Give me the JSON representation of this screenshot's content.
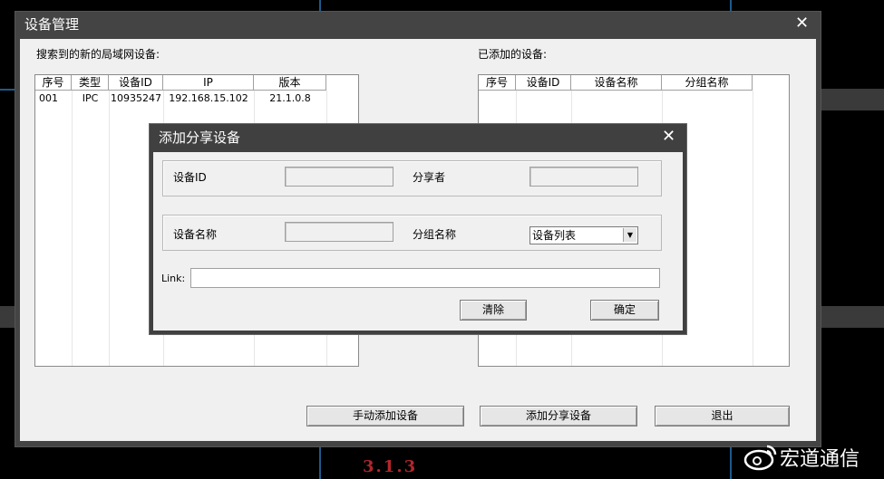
{
  "window": {
    "title": "设备管理"
  },
  "left_panel": {
    "label": "搜索到的新的局域网设备:",
    "columns": [
      "序号",
      "类型",
      "设备ID",
      "IP",
      "版本"
    ],
    "rows": [
      [
        "001",
        "IPC",
        "10935247",
        "192.168.15.102",
        "21.1.0.8"
      ]
    ]
  },
  "right_panel": {
    "label": "已添加的设备:",
    "columns": [
      "序号",
      "设备ID",
      "设备名称",
      "分组名称"
    ]
  },
  "dialog": {
    "title": "添加分享设备",
    "device_id_label": "设备ID",
    "sharer_label": "分享者",
    "device_name_label": "设备名称",
    "group_name_label": "分组名称",
    "group_select_value": "设备列表",
    "link_label": "Link:",
    "clear_button": "清除",
    "ok_button": "确定"
  },
  "buttons": {
    "manual_add": "手动添加设备",
    "add_shared": "添加分享设备",
    "exit": "退出"
  },
  "caption": "3.1.3",
  "watermark": "宏道通信",
  "icons": {
    "close": "close-icon",
    "dropdown": "chevron-down-icon",
    "weibo": "weibo-logo"
  }
}
